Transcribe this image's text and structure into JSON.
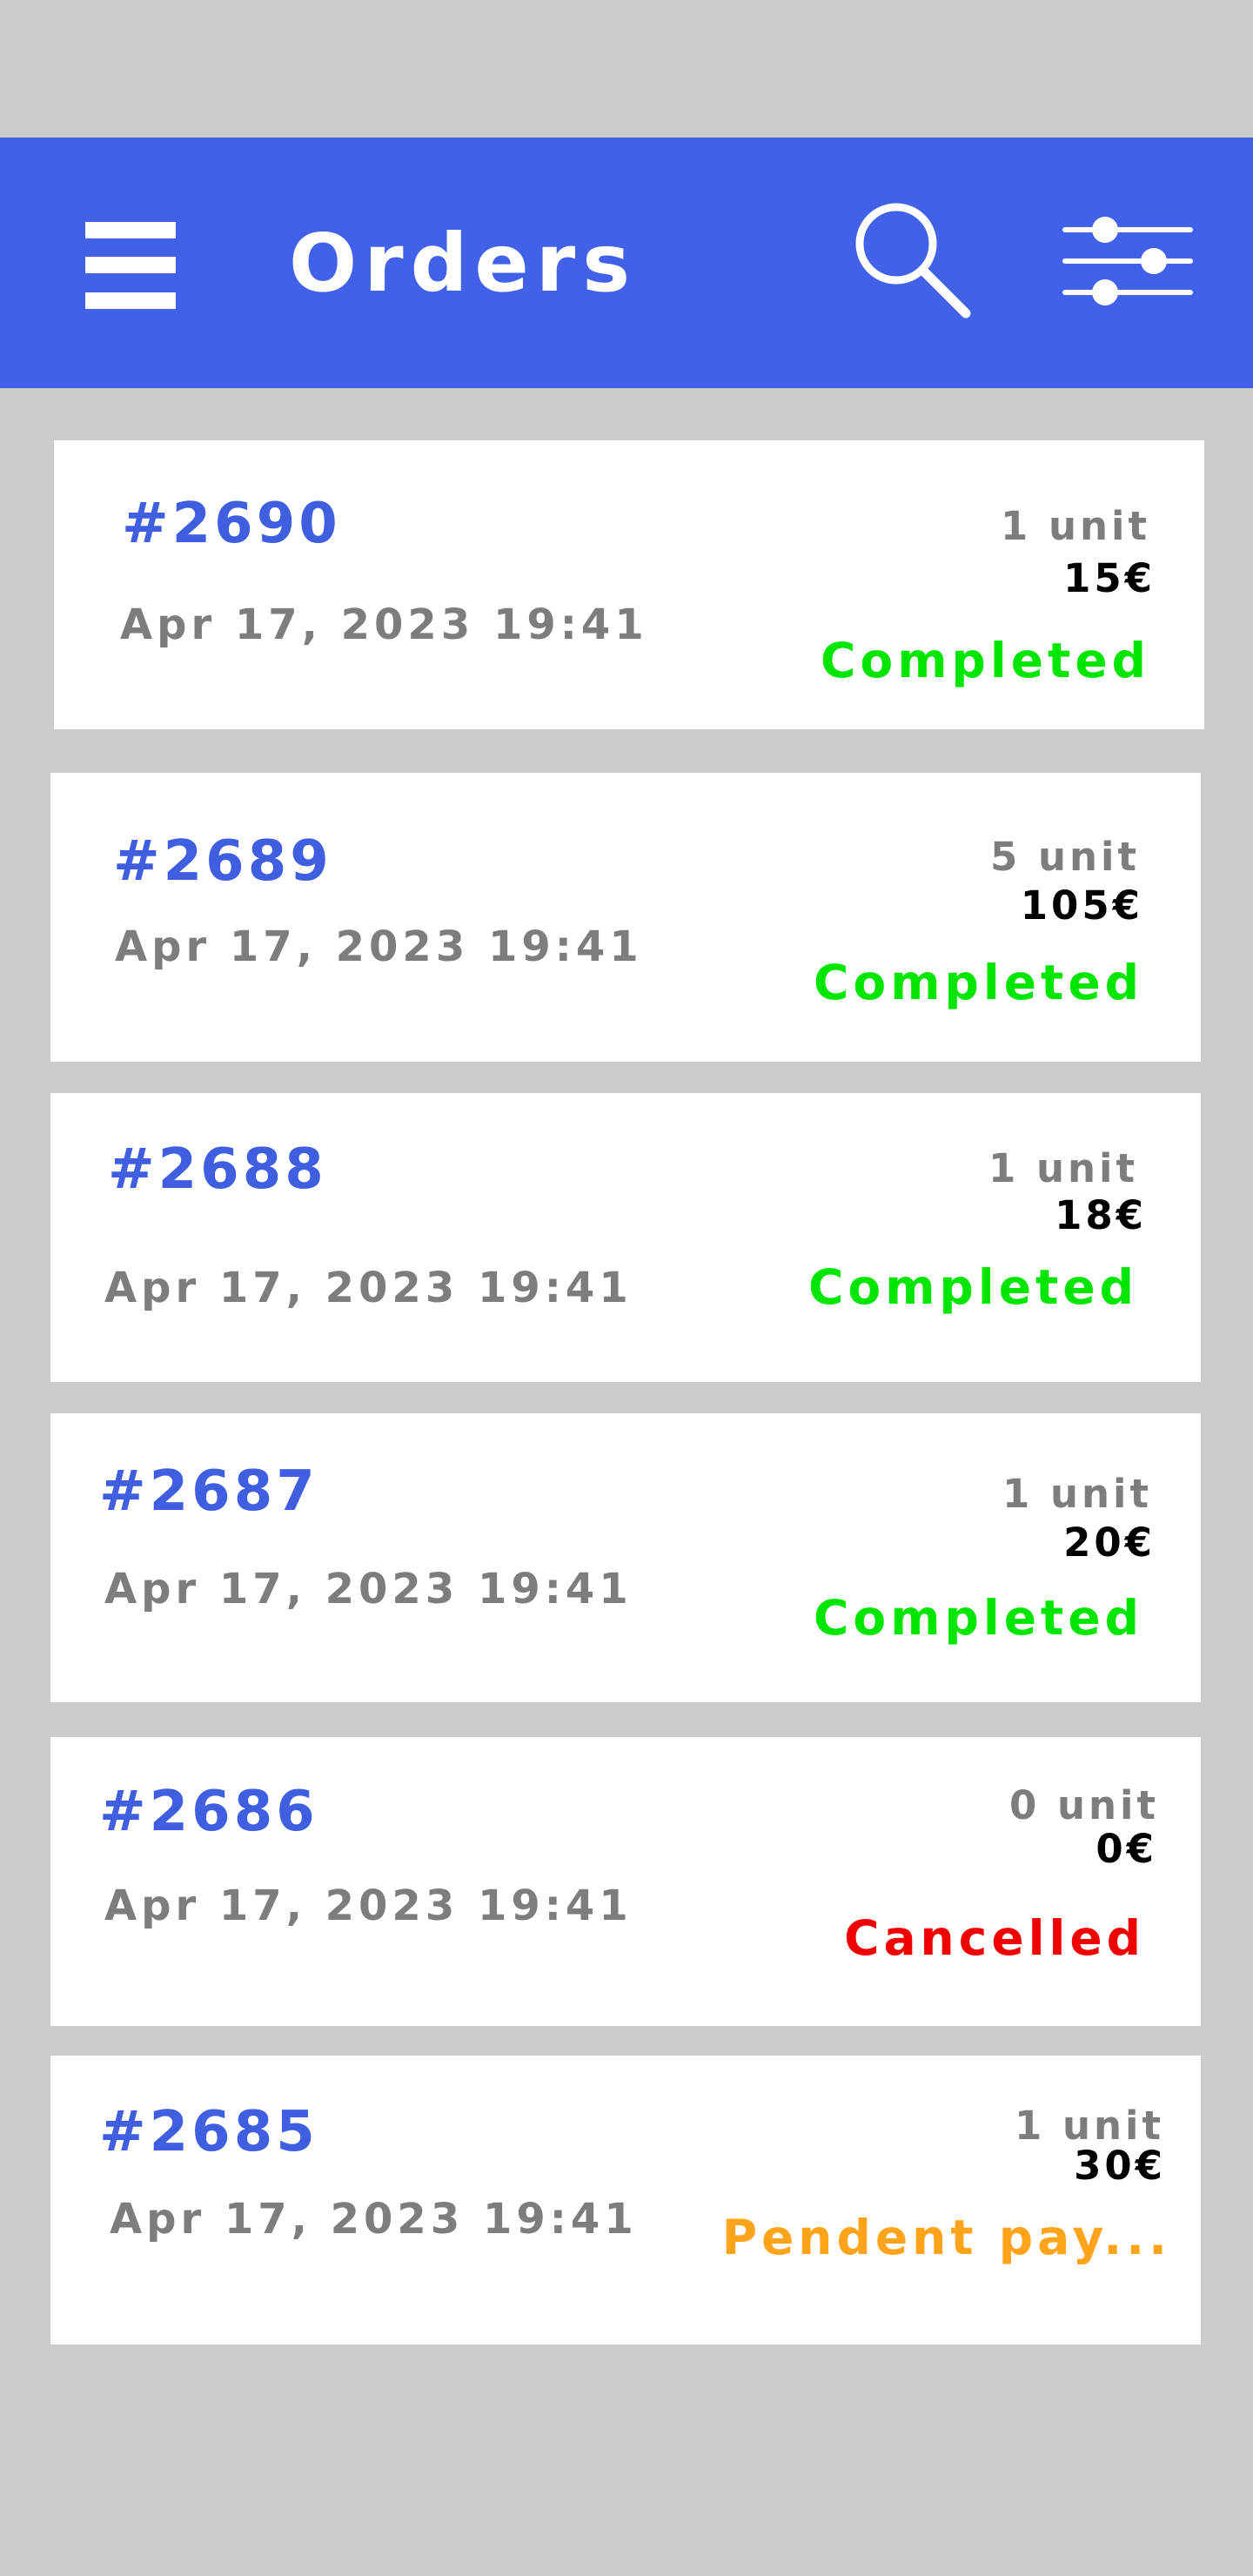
{
  "app_bar": {
    "title": "Orders",
    "background_color": "#4061e8",
    "icons": [
      "menu-icon",
      "search-icon",
      "filter-sliders-icon"
    ]
  },
  "status_colors": {
    "completed": "#00e600",
    "cancelled": "#f00000",
    "pending": "#ffa31a"
  },
  "orders": [
    {
      "id": "#2690",
      "date": "Apr 17, 2023 19:41",
      "units": "1 unit",
      "price": "15€",
      "status": "Completed",
      "status_color": "#00e600"
    },
    {
      "id": "#2689",
      "date": "Apr 17, 2023 19:41",
      "units": "5 unit",
      "price": "105€",
      "status": "Completed",
      "status_color": "#00e600"
    },
    {
      "id": "#2688",
      "date": "Apr 17, 2023 19:41",
      "units": "1 unit",
      "price": "18€",
      "status": "Completed",
      "status_color": "#00e600"
    },
    {
      "id": "#2687",
      "date": "Apr 17, 2023 19:41",
      "units": "1 unit",
      "price": "20€",
      "status": "Completed",
      "status_color": "#00e600"
    },
    {
      "id": "#2686",
      "date": "Apr 17, 2023 19:41",
      "units": "0 unit",
      "price": "0€",
      "status": "Cancelled",
      "status_color": "#f00000"
    },
    {
      "id": "#2685",
      "date": "Apr 17, 2023 19:41",
      "units": "1 unit",
      "price": "30€",
      "status": "Pendent pay...",
      "status_color": "#ffa31a"
    }
  ]
}
